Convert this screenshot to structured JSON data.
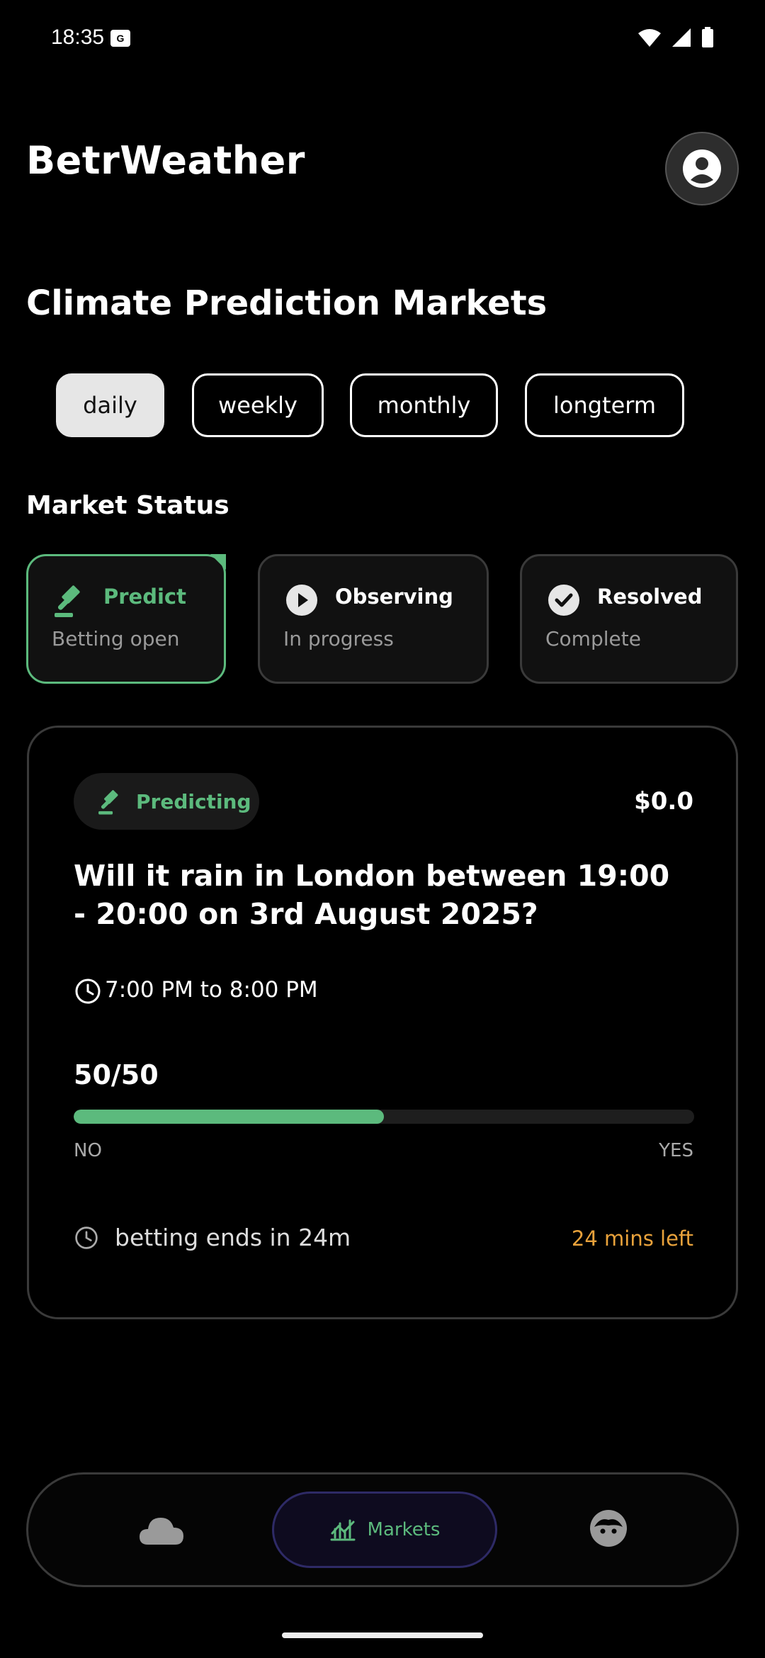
{
  "status_bar": {
    "time": "18:35"
  },
  "header": {
    "title": "BetrWeather"
  },
  "page_title": "Climate Prediction Markets",
  "tabs": [
    {
      "label": "daily",
      "active": true
    },
    {
      "label": "weekly",
      "active": false
    },
    {
      "label": "monthly",
      "active": false
    },
    {
      "label": "longterm",
      "active": false
    }
  ],
  "market_status": {
    "title": "Market Status",
    "cards": [
      {
        "title": "Predict",
        "subtitle": "Betting open",
        "icon": "gavel-icon",
        "active": true
      },
      {
        "title": "Observing",
        "subtitle": "In progress",
        "icon": "play-icon",
        "active": false
      },
      {
        "title": "Resolved",
        "subtitle": "Complete",
        "icon": "check-icon",
        "active": false
      }
    ]
  },
  "market": {
    "status_pill": "Predicting",
    "price": "$0.0",
    "question": "Will it rain in London between 19:00 - 20:00 on 3rd August 2025?",
    "time_window": "7:00 PM to 8:00 PM",
    "ratio": "50/50",
    "progress": 0.5,
    "label_no": "NO",
    "label_yes": "YES",
    "betting_ends": "betting ends in 24m",
    "time_left": "24 mins left"
  },
  "colors": {
    "accent": "#5cba7d",
    "warning": "#e9a23b",
    "background": "#000000"
  },
  "bottom_nav": {
    "items": [
      {
        "icon": "cloud-icon"
      },
      {
        "icon": "chart-icon",
        "label": "Markets",
        "active": true
      },
      {
        "icon": "face-icon"
      }
    ]
  }
}
